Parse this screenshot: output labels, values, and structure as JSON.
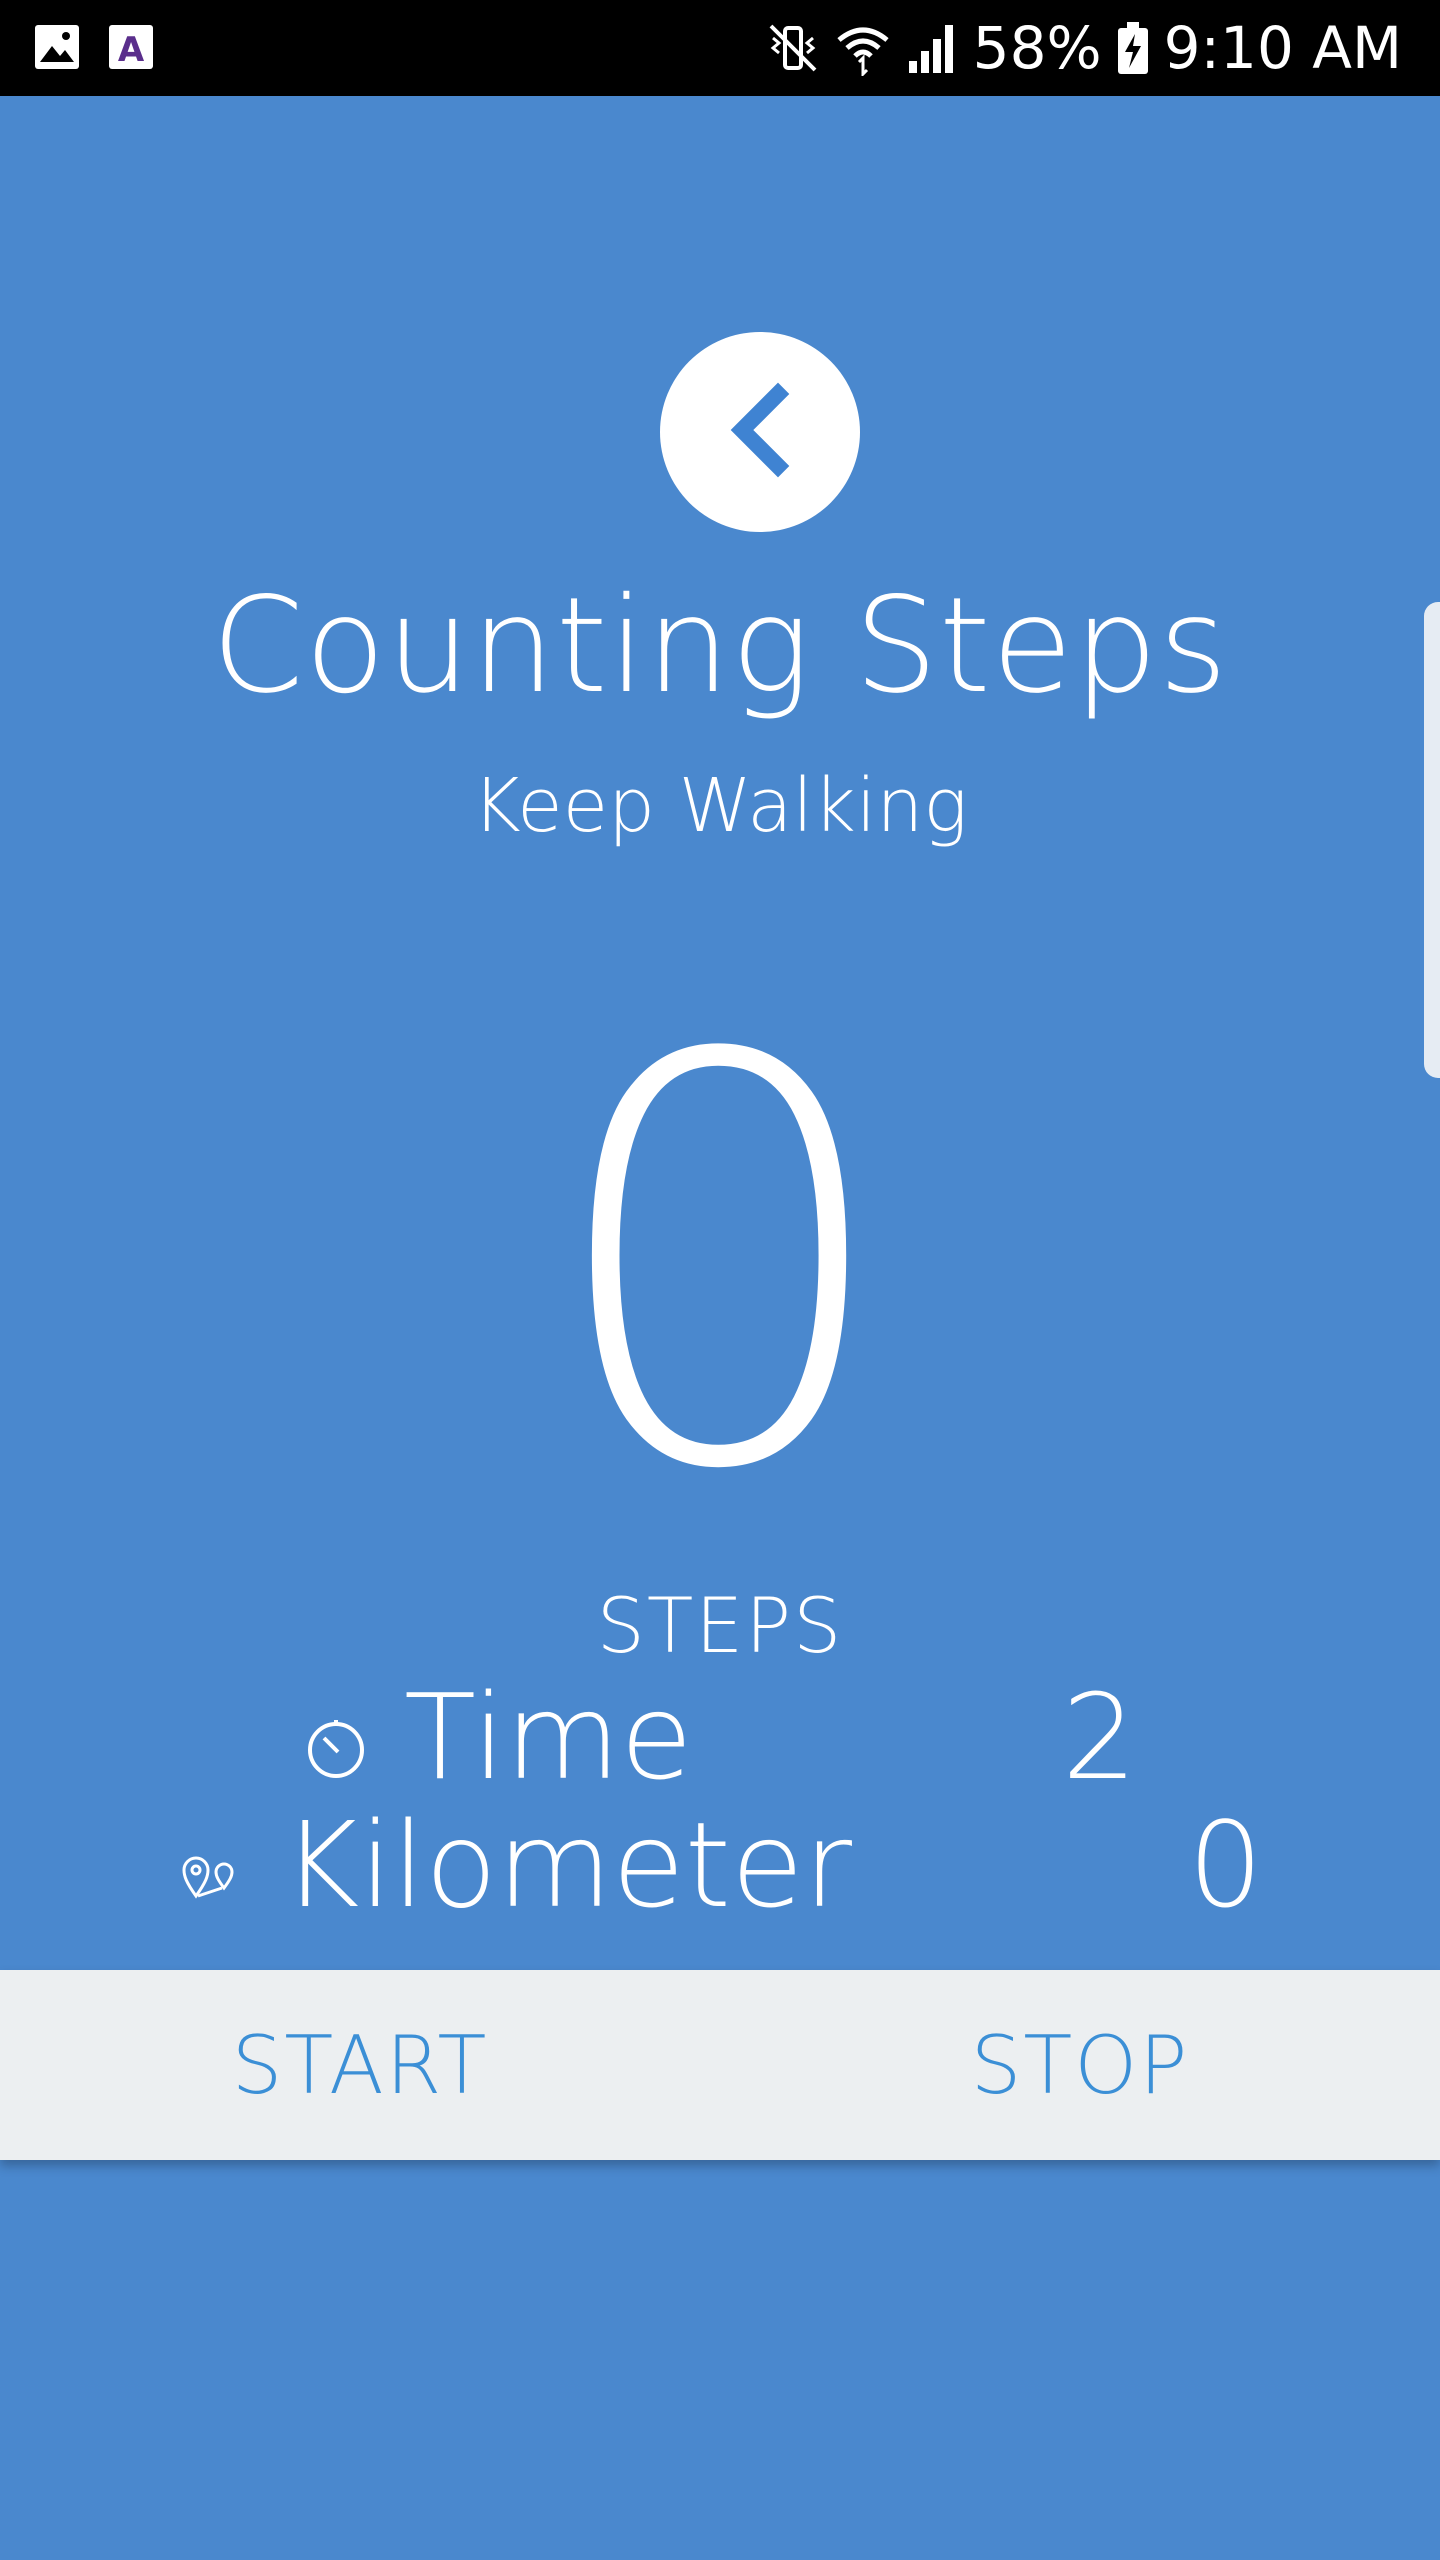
{
  "status_bar": {
    "battery": "58%",
    "time": "9:10 AM",
    "icons": [
      "gallery-icon",
      "app-a-icon",
      "mute-vibrate-icon",
      "wifi-icon",
      "signal-icon",
      "battery-charging-icon"
    ],
    "app_icon_letter": "A"
  },
  "header": {
    "back_icon": "chevron-left-icon",
    "title": "Counting Steps",
    "subtitle": "Keep Walking"
  },
  "counter": {
    "value": "0",
    "label": "STEPS"
  },
  "stats": {
    "time": {
      "icon": "stopwatch-icon",
      "label": "Time",
      "value": "2"
    },
    "distance": {
      "icon": "map-pins-icon",
      "label": "Kilometer",
      "value": "0"
    }
  },
  "actions": {
    "start_label": "START",
    "stop_label": "STOP"
  },
  "colors": {
    "background": "#4a88ce",
    "action_bar": "#eceff1",
    "action_text": "#3b8fd6",
    "text": "#ffffff"
  }
}
